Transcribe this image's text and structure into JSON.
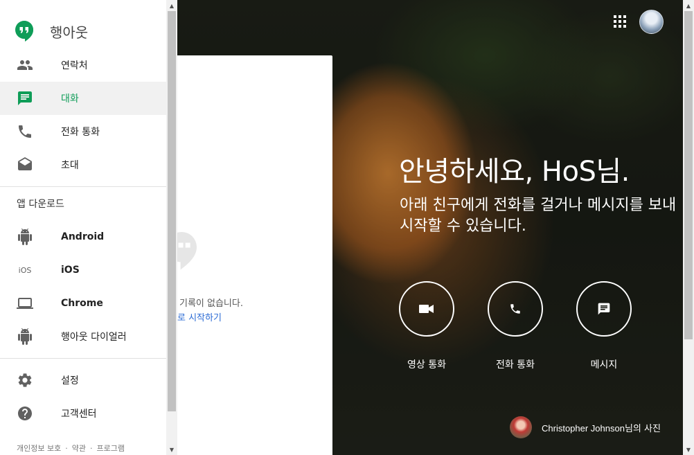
{
  "app": {
    "name": "행아웃"
  },
  "nav": {
    "items": [
      {
        "label": "연락처",
        "icon": "people-icon"
      },
      {
        "label": "대화",
        "icon": "chat-icon",
        "active": true
      },
      {
        "label": "전화 통화",
        "icon": "phone-icon"
      },
      {
        "label": "초대",
        "icon": "mail-icon"
      }
    ],
    "download_title": "앱 다운로드",
    "downloads": [
      {
        "label": "Android",
        "icon": "android-icon"
      },
      {
        "label": "iOS",
        "icon": "ios-icon"
      },
      {
        "label": "Chrome",
        "icon": "laptop-icon"
      },
      {
        "label": "행아웃 다이얼러",
        "icon": "android-icon"
      }
    ],
    "settings_label": "설정",
    "help_label": "고객센터",
    "footer": {
      "privacy": "개인정보 보호",
      "terms": "약관",
      "program": "프로그램"
    }
  },
  "conversations": {
    "empty_text": "기록이 없습니다.",
    "start_link": "로 시작하기"
  },
  "main": {
    "greeting": "안녕하세요, HoS님.",
    "subtitle": "아래 친구에게 전화를 걸거나 메시지를 보내 시작할 수 있습니다.",
    "actions": [
      {
        "label": "영상 통화",
        "icon": "video-icon"
      },
      {
        "label": "전화 통화",
        "icon": "phone-icon"
      },
      {
        "label": "메시지",
        "icon": "message-icon"
      }
    ],
    "photo_credit": {
      "name": "Christopher Johnson",
      "suffix": "님의 사진"
    }
  },
  "colors": {
    "accent": "#0f9d58",
    "link": "#2a6ad4"
  }
}
